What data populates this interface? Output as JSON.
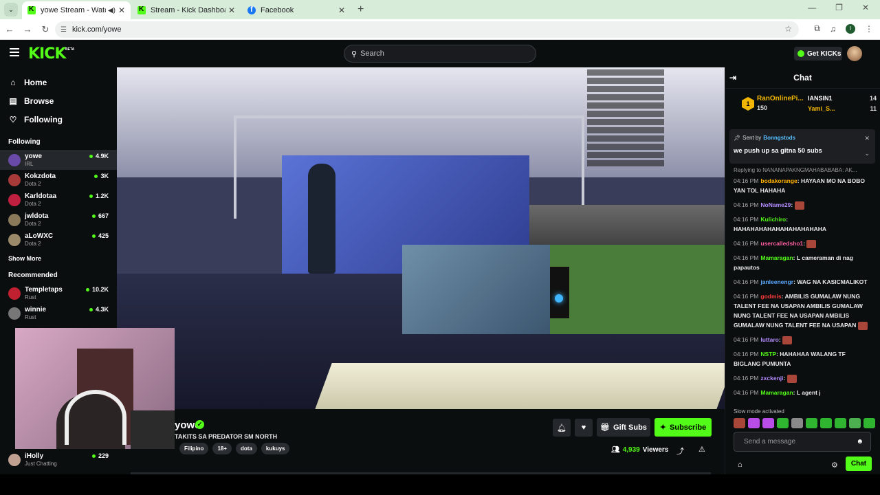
{
  "browser": {
    "tabs": [
      {
        "title": "yowe Stream - Watch Live o",
        "favicon": "kick",
        "active": true,
        "audio": true
      },
      {
        "title": "Stream - Kick Dashboard",
        "favicon": "kick",
        "active": false
      },
      {
        "title": "Facebook",
        "favicon": "facebook",
        "active": false
      }
    ],
    "url": "kick.com/yowe",
    "profile_initial": "I"
  },
  "header": {
    "logo": "KICK",
    "beta": "BETA",
    "search_placeholder": "Search",
    "get_kicks_label": "Get KICKs",
    "accent": "#53fc18"
  },
  "sidebar": {
    "nav": [
      {
        "label": "Home",
        "icon": "home-icon"
      },
      {
        "label": "Browse",
        "icon": "browse-icon"
      },
      {
        "label": "Following",
        "icon": "heart-icon"
      }
    ],
    "following_title": "Following",
    "following": [
      {
        "name": "yowe",
        "category": "IRL",
        "viewers": "4.9K",
        "color": "#6a4aa8"
      },
      {
        "name": "Kokzdota",
        "category": "Dota 2",
        "viewers": "3K",
        "color": "#a83a3a"
      },
      {
        "name": "Karldotaa",
        "category": "Dota 2",
        "viewers": "1.2K",
        "color": "#c02040"
      },
      {
        "name": "jwldota",
        "category": "Dota 2",
        "viewers": "667",
        "color": "#8a7a5a"
      },
      {
        "name": "aLoWXC",
        "category": "Dota 2",
        "viewers": "425",
        "color": "#9a8a6a"
      }
    ],
    "show_more": "Show More",
    "recommended_title": "Recommended",
    "recommended": [
      {
        "name": "Templetaps",
        "category": "Rust",
        "viewers": "10.2K",
        "color": "#c02030"
      },
      {
        "name": "winnie",
        "category": "Rust",
        "viewers": "4.3K",
        "color": "#777777"
      }
    ],
    "bottom_channel": {
      "name": "iHolly",
      "category": "Just Chatting",
      "viewers": "229",
      "color": "#c0a090"
    }
  },
  "stream": {
    "name": "yowe",
    "title": "TAKITS SA PREDATOR SM NORTH",
    "tags": [
      "Filipino",
      "18+",
      "dota",
      "kukuys"
    ],
    "gift_subs_label": "Gift Subs",
    "subscribe_label": "Subscribe",
    "viewers": "4,939",
    "viewers_label": "Viewers"
  },
  "chat": {
    "title": "Chat",
    "leaderboard": {
      "top": {
        "rank": "1",
        "name": "RanOnlinePi...",
        "count": "150"
      },
      "others": [
        {
          "name": "IANSIN1",
          "count": "14",
          "color": "#ffffff"
        },
        {
          "name": "Yami_S...",
          "count": "11",
          "color": "#f2b705"
        }
      ]
    },
    "pinned": {
      "sent_by_label": "Sent by",
      "sender": "Bonngstods",
      "message": "we push up sa gitna 50 subs"
    },
    "reply_to": "Replying to NANANAPAKNGMAHABABABA: AK...",
    "messages": [
      {
        "time": "04:16 PM",
        "user": "bodakorange",
        "color": "#ffb000",
        "text": "HAYAAN MO NA BOBO YAN TOL HAHAHA",
        "emote": false
      },
      {
        "time": "04:16 PM",
        "user": "NoName29",
        "color": "#b48cff",
        "text": "",
        "emote": true
      },
      {
        "time": "04:16 PM",
        "user": "Kulichiro",
        "color": "#53fc18",
        "text": "HAHAHAHAHAHAHAHAHAHAHA",
        "emote": false
      },
      {
        "time": "04:16 PM",
        "user": "usercalledsho1",
        "color": "#ff5fa2",
        "text": "",
        "emote": true
      },
      {
        "time": "04:16 PM",
        "user": "Mamaragan",
        "color": "#53fc18",
        "text": "L cameraman di nag papautos",
        "emote": false
      },
      {
        "time": "04:16 PM",
        "user": "janleenengr",
        "color": "#5aa8ff",
        "text": "WAG NA KASICMALIKOT",
        "emote": false
      },
      {
        "time": "04:16 PM",
        "user": "godmis",
        "color": "#ff3b3b",
        "text": "AMBILIS GUMALAW NUNG TALENT FEE NA USAPAN  AMBILIS GUMALAW NUNG TALENT FEE NA USAPAN  AMBILIS GUMALAW NUNG TALENT FEE NA USAPAN",
        "emote": true
      },
      {
        "time": "04:16 PM",
        "user": "luttaro",
        "color": "#b48cff",
        "text": "",
        "emote": true
      },
      {
        "time": "04:16 PM",
        "user": "NSTP",
        "color": "#53fc18",
        "text": "HAHAHAA WALANG TF BIGLANG PUMUNTA",
        "emote": false
      },
      {
        "time": "04:16 PM",
        "user": "zxckenji",
        "color": "#b48cff",
        "text": "",
        "emote": true
      },
      {
        "time": "04:16 PM",
        "user": "Mamaragan",
        "color": "#53fc18",
        "text": "L agent j",
        "emote": false
      }
    ],
    "slow_mode": "Slow mode activated",
    "input_placeholder": "Send a message",
    "send_label": "Chat"
  }
}
